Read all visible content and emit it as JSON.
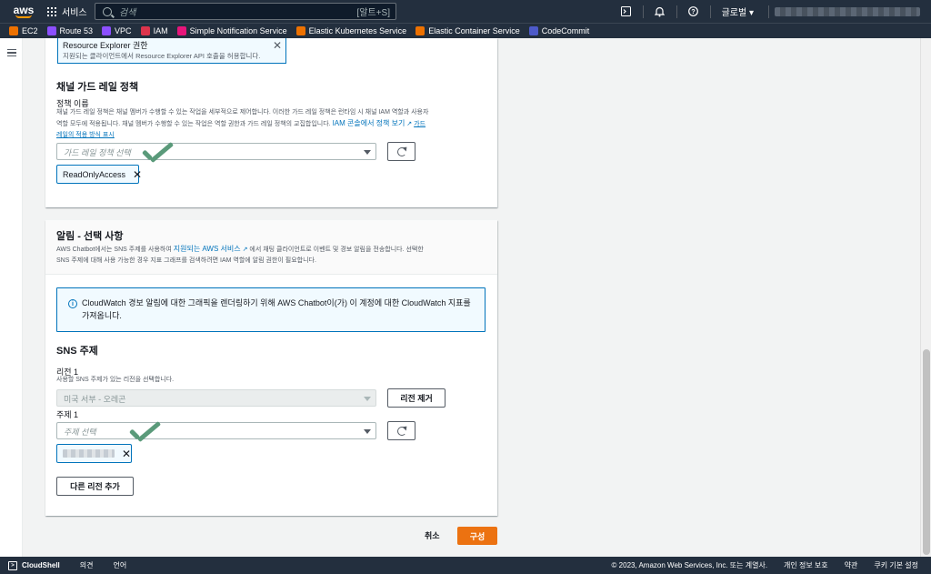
{
  "topnav": {
    "logo": "aws",
    "services_label": "서비스",
    "search_placeholder": "검색",
    "search_shortcut": "[알트+S]",
    "region_label": "글로벌",
    "icons": [
      "cloudshell-icon",
      "bell-icon",
      "help-icon"
    ]
  },
  "favorites": [
    {
      "label": "EC2",
      "color": "#ed7100"
    },
    {
      "label": "Route 53",
      "color": "#8c4fff"
    },
    {
      "label": "VPC",
      "color": "#8c4fff"
    },
    {
      "label": "IAM",
      "color": "#dd344c"
    },
    {
      "label": "Simple Notification Service",
      "color": "#e7157b"
    },
    {
      "label": "Elastic Kubernetes Service",
      "color": "#ed7100"
    },
    {
      "label": "Elastic Container Service",
      "color": "#ed7100"
    },
    {
      "label": "CodeCommit",
      "color": "#4d5ac9"
    }
  ],
  "panel1": {
    "info_title": "Resource Explorer 권한",
    "info_desc": "지원되는 클라이언트에서 Resource Explorer API 호출을 허용합니다.",
    "section_title": "채널 가드 레일 정책",
    "field_label": "정책 이름",
    "desc_line1": "채널 가드 레일 정책은 채널 멤버가 수행할 수 있는 작업을 세부적으로 제어합니다. 이러한 가드 레일 정책은 런타임 시 채널 IAM 역할과 사용자",
    "desc_line2_prefix": "역할 모두에 적용됩니다. 채널 멤버가 수행할 수 있는 작업은 역할 권한과 가드 레일 정책의 교집합입니다.",
    "desc_link": "IAM 콘솔에서 정책 보기",
    "desc_link2_a": "가드",
    "desc_link2_b": "레일의 적용 방식 표시",
    "select_placeholder": "가드 레일 정책 선택",
    "token": "ReadOnlyAccess"
  },
  "panel2": {
    "title": "알림 - 선택 사항",
    "desc_prefix": "AWS Chatbot에서는 SNS 주제를 사용하여",
    "desc_link": "지원되는 AWS 서비스",
    "desc_suffix": "에서 채팅 클라이언트로 이벤트 및 경보 알림을 전송합니다. 선택한",
    "desc_line2": "SNS 주제에 대해 사용 가능한 경우 지표 그래프를 검색하려면 IAM 역할에 알림 권한이 필요합니다.",
    "alert_text": "CloudWatch 경보 알림에 대한 그래픽을 렌더링하기 위해 AWS Chatbot이(가) 이 계정에 대한 CloudWatch 지표를 가져옵니다.",
    "sns_title": "SNS 주제",
    "region_label": "리전 1",
    "region_desc": "사용할 SNS 주제가 있는 리전을 선택합니다.",
    "region_value": "미국 서부 - 오레곤",
    "remove_region": "리전 제거",
    "topic_label": "주제 1",
    "topic_placeholder": "주제 선택",
    "add_region": "다른 리전 추가"
  },
  "actions": {
    "cancel": "취소",
    "submit": "구성"
  },
  "footer": {
    "cloudshell": "CloudShell",
    "feedback": "의견",
    "language": "언어",
    "copyright": "© 2023, Amazon Web Services, Inc. 또는 계열사.",
    "privacy": "개인 정보 보호",
    "terms": "약관",
    "cookies": "쿠키 기본 설정"
  },
  "colors": {
    "nav": "#232f3e",
    "link": "#0073bb",
    "primary": "#ec7211",
    "check": "#5a9a7a"
  }
}
